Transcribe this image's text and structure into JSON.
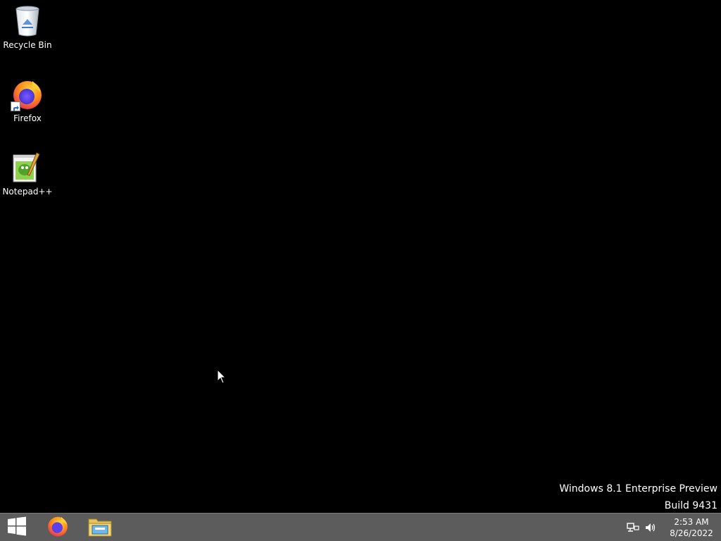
{
  "desktop": {
    "background": "#000000",
    "icons": [
      {
        "label": "Recycle Bin",
        "icon": "recycle-bin-icon"
      },
      {
        "label": "Firefox",
        "icon": "firefox-icon",
        "shortcut": true
      },
      {
        "label": "Notepad++",
        "icon": "notepad-plus-plus-icon"
      }
    ],
    "watermark": {
      "line1": "Windows 8.1 Enterprise Preview",
      "line2": "Build 9431"
    }
  },
  "taskbar": {
    "background": "#5c5c5c",
    "pinned": [
      {
        "name": "start-button",
        "icon": "windows-logo-icon"
      },
      {
        "name": "firefox",
        "icon": "firefox-icon"
      },
      {
        "name": "file-explorer",
        "icon": "file-explorer-icon"
      }
    ],
    "tray": {
      "icons": [
        "network-icon",
        "volume-icon"
      ],
      "time": "2:53 AM",
      "date": "8/26/2022"
    }
  }
}
